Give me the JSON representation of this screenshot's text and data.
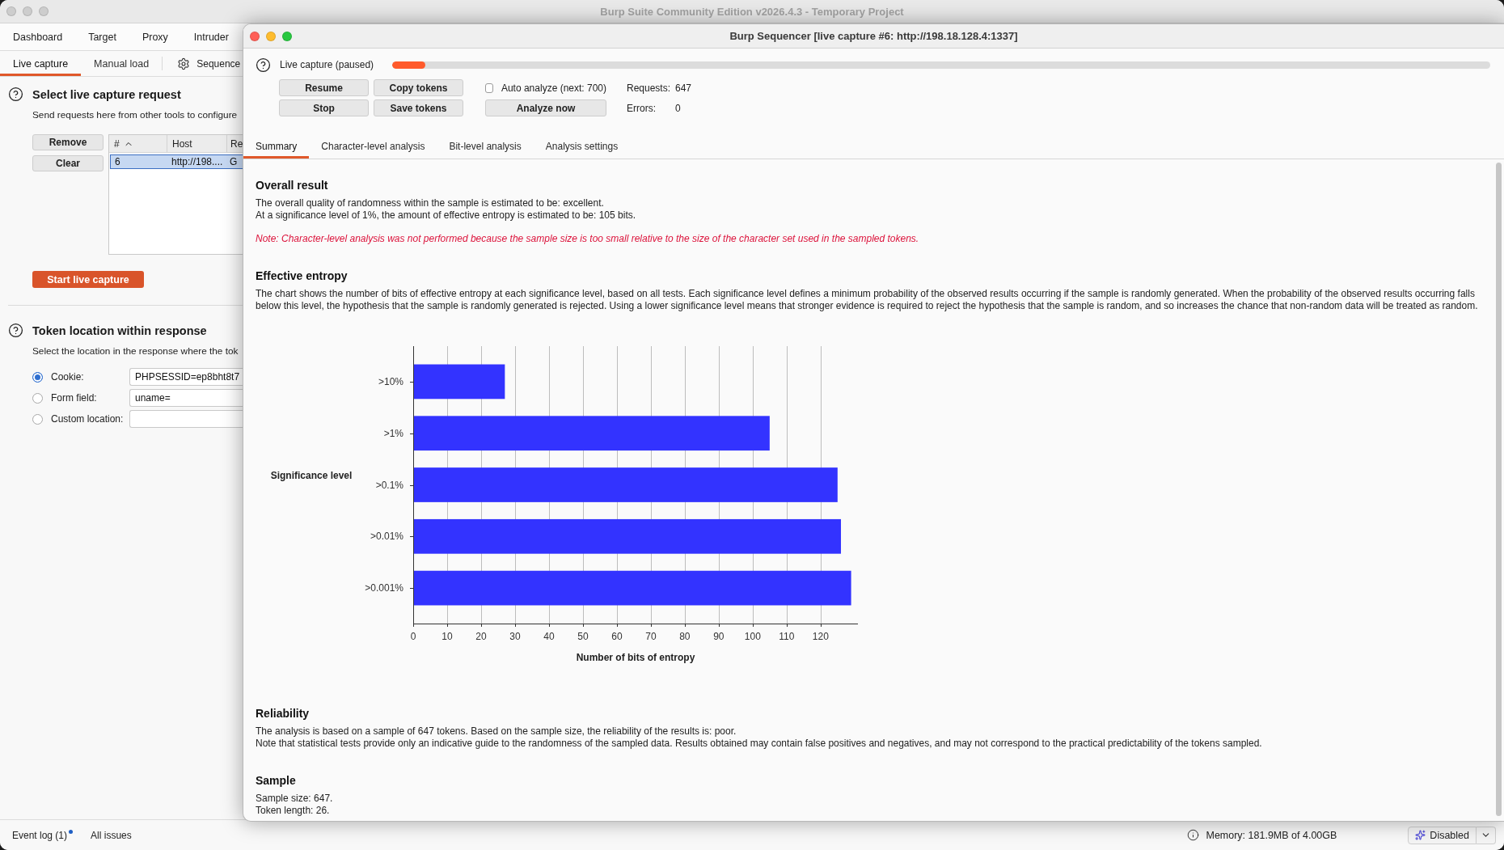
{
  "background_window": {
    "title": "Burp Suite Community Edition v2026.4.3 - Temporary Project",
    "tabs": [
      {
        "label": "Dashboard"
      },
      {
        "label": "Target"
      },
      {
        "label": "Proxy"
      },
      {
        "label": "Intruder"
      }
    ],
    "subtabs": [
      {
        "label": "Live capture",
        "selected": true
      },
      {
        "label": "Manual load",
        "selected": false
      }
    ],
    "settings_button": {
      "label": "Sequence"
    },
    "capture_request": {
      "title": "Select live capture request",
      "description": "Send requests here from other tools to configure",
      "buttons": [
        "Remove",
        "Clear"
      ],
      "table": {
        "columns": [
          {
            "label": "#",
            "sorted": true
          },
          {
            "label": "Host",
            "sorted": false
          },
          {
            "label": "Re",
            "sorted": false
          }
        ],
        "rows": [
          {
            "cells": [
              "6",
              "http://198....",
              "G"
            ],
            "selected": true
          }
        ]
      },
      "start_button": "Start live capture"
    },
    "token_location": {
      "title": "Token location within response",
      "description": "Select the location in the response where the tok",
      "options": [
        {
          "label": "Cookie:",
          "value": "PHPSESSID=ep8bht8t7",
          "selected": true
        },
        {
          "label": "Form field:",
          "value": "uname=",
          "selected": false
        },
        {
          "label": "Custom location:",
          "selected": false
        }
      ]
    },
    "status_bar": {
      "items": [
        {
          "label": "Event log (1)",
          "unread": true
        },
        {
          "label": "All issues",
          "unread": false
        }
      ],
      "memory": "Memory: 181.9MB of 4.00GB",
      "assistant_button": "Disabled"
    }
  },
  "sequencer": {
    "title": "Burp Sequencer [live capture #6: http://198.18.128.4:1337]",
    "capture": {
      "status": "Live capture (paused)",
      "level": 0.03
    },
    "controls": [
      {
        "buttons": [
          "Resume",
          "Copy tokens"
        ],
        "option": {
          "kind": "checkbox",
          "label": "Auto analyze (next: 700)",
          "checked": false
        },
        "stat": {
          "label": "Requests:",
          "value": "647"
        }
      },
      {
        "buttons": [
          "Stop",
          "Save tokens"
        ],
        "option": {
          "kind": "button",
          "label": "Analyze now"
        },
        "stat": {
          "label": "Errors:",
          "value": "0"
        }
      }
    ],
    "tabs": [
      {
        "label": "Summary",
        "selected": true
      },
      {
        "label": "Character-level analysis",
        "selected": false
      },
      {
        "label": "Bit-level analysis",
        "selected": false
      },
      {
        "label": "Analysis settings",
        "selected": false
      }
    ],
    "summary": {
      "sections": [
        {
          "kind": "text",
          "title": "Overall result",
          "lines": [
            "The overall quality of randomness within the sample is estimated to be: excellent.",
            "At a significance level of 1%, the amount of effective entropy is estimated to be: 105 bits."
          ],
          "note": "Note: Character-level analysis was not performed because the sample size is too small relative to the size of the character set used in the sampled tokens."
        },
        {
          "kind": "chart",
          "title": "Effective entropy",
          "lines": [
            "The chart shows the number of bits of effective entropy at each significance level, based on all tests. Each significance level defines a minimum probability of the observed results occurring if the sample is randomly generated. When the probability of the observed results occurring falls below this level, the hypothesis that the sample is randomly generated is rejected. Using a lower significance level means that stronger evidence is required to reject the hypothesis that the sample is random, and so increases the chance that non-random data will be treated as random."
          ],
          "chart_data": {
            "type": "bar",
            "orientation": "horizontal",
            "grid": true,
            "xlabel": "Number of bits of entropy",
            "ylabel": "Significance level",
            "categories": [
              ">10%",
              ">1%",
              ">0.1%",
              ">0.01%",
              ">0.001%"
            ],
            "series": [
              {
                "color": "#3333ff",
                "values": [
                  27,
                  105,
                  125,
                  126,
                  129
                ]
              }
            ],
            "xlim": [
              0,
              131
            ],
            "xticks": [
              0,
              10,
              20,
              30,
              40,
              50,
              60,
              70,
              80,
              90,
              100,
              110,
              120
            ]
          }
        },
        {
          "kind": "text",
          "title": "Reliability",
          "lines": [
            "The analysis is based on a sample of 647 tokens. Based on the sample size, the reliability of the results is: poor.",
            "Note that statistical tests provide only an indicative guide to the randomness of the sampled data. Results obtained may contain false positives and negatives, and may not correspond to the practical predictability of the tokens sampled."
          ]
        },
        {
          "kind": "text",
          "title": "Sample",
          "lines": [
            "Sample size: 647.",
            "Token length: 26."
          ]
        }
      ]
    }
  }
}
